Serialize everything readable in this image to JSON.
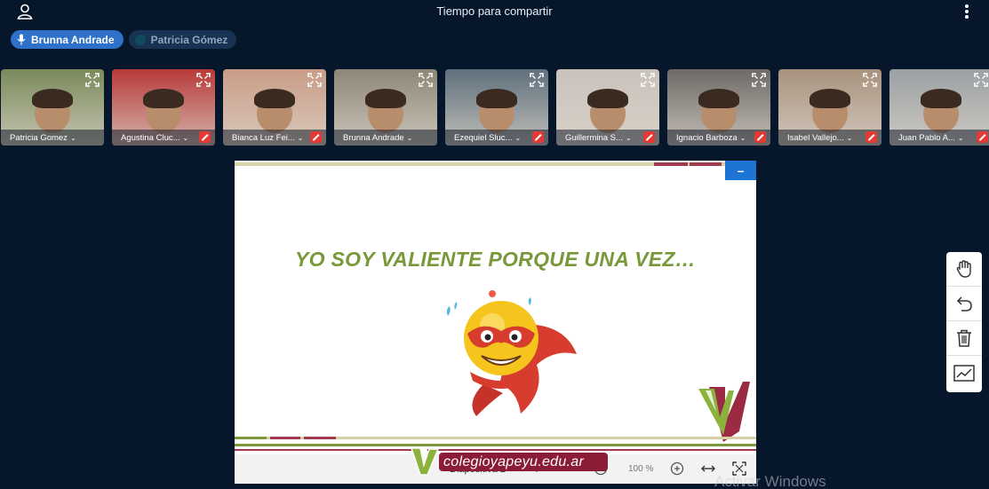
{
  "header": {
    "title": "Tiempo para compartir",
    "user_icon": "user-icon",
    "menu_icon": "kebab-menu-icon"
  },
  "speakers": [
    {
      "name": "Brunna Andrade",
      "state": "speaking",
      "icon": "microphone-icon"
    },
    {
      "name": "Patricia Gómez",
      "state": "idle"
    }
  ],
  "participants": [
    {
      "name": "Patricia Gomez",
      "muted": false,
      "bg": "#7a8a5a"
    },
    {
      "name": "Agustina Cluc...",
      "muted": true,
      "bg": "#b83a3a"
    },
    {
      "name": "Bianca Luz Fei...",
      "muted": true,
      "bg": "#c99c86"
    },
    {
      "name": "Brunna Andrade",
      "muted": false,
      "bg": "#8d8778"
    },
    {
      "name": "Ezequiel Sluc...",
      "muted": true,
      "bg": "#5f6f7c"
    },
    {
      "name": "Guillermina S...",
      "muted": true,
      "bg": "#c9c2bb"
    },
    {
      "name": "Ignacio Barboza",
      "muted": true,
      "bg": "#6d6a66"
    },
    {
      "name": "Isabel Vallejo...",
      "muted": true,
      "bg": "#a8927e"
    },
    {
      "name": "Juan Pablo A...",
      "muted": true,
      "bg": "#9ba0a3"
    }
  ],
  "slide": {
    "heading": "YO SOY VALIENTE PORQUE UNA VEZ…",
    "minimize_label": "–",
    "slide_label": "Diapositiva 2",
    "zoom": "100 %",
    "brand": "colegioyapeyu.edu.ar",
    "colors": {
      "green": "#78983a",
      "maroon": "#a23a4e"
    }
  },
  "os_watermark": "Activar Windows",
  "tools": [
    "hand-icon",
    "undo-icon",
    "trash-icon",
    "chart-icon"
  ]
}
